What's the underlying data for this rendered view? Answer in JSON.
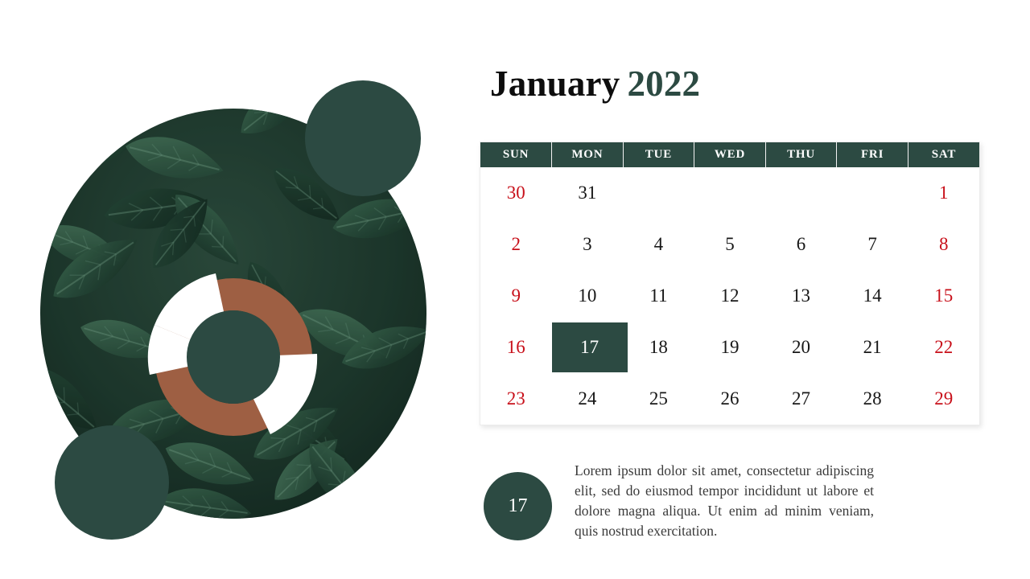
{
  "title": {
    "month": "January",
    "year": "2022",
    "month_color": "#0d0d0d",
    "year_color": "#2c4a42"
  },
  "theme": {
    "green": "#2c4a42",
    "terracotta": "#9e5f43",
    "weekend_red": "#c8101a",
    "weekday_black": "#171717",
    "background": "#ffffff"
  },
  "calendar": {
    "weekday_headers": [
      "SUN",
      "MON",
      "TUE",
      "WED",
      "THU",
      "FRI",
      "SAT"
    ],
    "selected_day": "17",
    "weeks": [
      [
        {
          "label": "30",
          "kind": "weekend-outside"
        },
        {
          "label": "31",
          "kind": "weekday-outside"
        },
        {
          "label": "",
          "kind": "empty"
        },
        {
          "label": "",
          "kind": "empty"
        },
        {
          "label": "",
          "kind": "empty"
        },
        {
          "label": "",
          "kind": "empty"
        },
        {
          "label": "1",
          "kind": "weekend"
        }
      ],
      [
        {
          "label": "2",
          "kind": "weekend"
        },
        {
          "label": "3",
          "kind": "weekday"
        },
        {
          "label": "4",
          "kind": "weekday"
        },
        {
          "label": "5",
          "kind": "weekday"
        },
        {
          "label": "6",
          "kind": "weekday"
        },
        {
          "label": "7",
          "kind": "weekday"
        },
        {
          "label": "8",
          "kind": "weekend"
        }
      ],
      [
        {
          "label": "9",
          "kind": "weekend"
        },
        {
          "label": "10",
          "kind": "weekday"
        },
        {
          "label": "11",
          "kind": "weekday"
        },
        {
          "label": "12",
          "kind": "weekday"
        },
        {
          "label": "13",
          "kind": "weekday"
        },
        {
          "label": "14",
          "kind": "weekday"
        },
        {
          "label": "15",
          "kind": "weekend"
        }
      ],
      [
        {
          "label": "16",
          "kind": "weekend"
        },
        {
          "label": "17",
          "kind": "today"
        },
        {
          "label": "18",
          "kind": "weekday"
        },
        {
          "label": "19",
          "kind": "weekday"
        },
        {
          "label": "20",
          "kind": "weekday"
        },
        {
          "label": "21",
          "kind": "weekday"
        },
        {
          "label": "22",
          "kind": "weekend"
        }
      ],
      [
        {
          "label": "23",
          "kind": "weekend"
        },
        {
          "label": "24",
          "kind": "weekday"
        },
        {
          "label": "25",
          "kind": "weekday"
        },
        {
          "label": "26",
          "kind": "weekday"
        },
        {
          "label": "27",
          "kind": "weekday"
        },
        {
          "label": "28",
          "kind": "weekday"
        },
        {
          "label": "29",
          "kind": "weekend"
        }
      ]
    ]
  },
  "note": {
    "day_badge": "17",
    "body": "Lorem ipsum dolor sit amet, consectetur adipiscing elit, sed do eiusmod tempor incididunt ut labore et dolore magna aliqua. Ut enim ad minim veniam, quis nostrud exercitation."
  },
  "graphic": {
    "photo_subject": "dark green leaves",
    "donut": {
      "segments": [
        {
          "name": "terracotta-major",
          "color": "#9e5f43",
          "start_deg": 315,
          "sweep_deg": 170
        },
        {
          "name": "white-upper-left",
          "color": "#ffffff",
          "start_deg": 235,
          "sweep_deg": 80
        },
        {
          "name": "terracotta-lower",
          "color": "#9e5f43",
          "start_deg": 125,
          "sweep_deg": 110
        },
        {
          "name": "white-lower-right",
          "color": "#ffffff",
          "start_deg": 125,
          "sweep_deg": -55
        }
      ],
      "center_color": "#2c4a42"
    },
    "accent_circles": [
      {
        "name": "top-right-circle",
        "color": "#2c4a42"
      },
      {
        "name": "bottom-left-circle",
        "color": "#2c4a42"
      }
    ]
  }
}
